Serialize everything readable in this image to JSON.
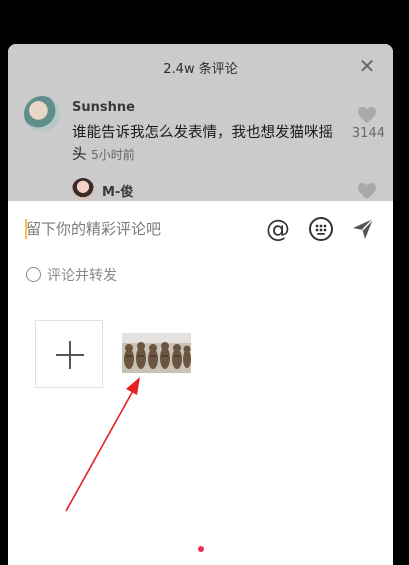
{
  "header": {
    "title": "2.4w 条评论"
  },
  "comments": [
    {
      "user": "Sunshne",
      "text": "谁能告诉我怎么发表情，我也想发猫咪摇头",
      "time": "5小时前",
      "likes": "3144"
    },
    {
      "user": "M-俊"
    }
  ],
  "composer": {
    "placeholder": "留下你的精彩评论吧",
    "at_symbol": "@",
    "repost_label": "评论并转发"
  },
  "icons": {
    "close": "close-icon",
    "like": "heart-icon",
    "emoji": "emoji-keyboard-icon",
    "send": "send-icon",
    "add": "plus-icon"
  },
  "colors": {
    "accent": "#ec2d55",
    "caret": "#f6c440",
    "annotation_arrow": "#e8201f"
  }
}
